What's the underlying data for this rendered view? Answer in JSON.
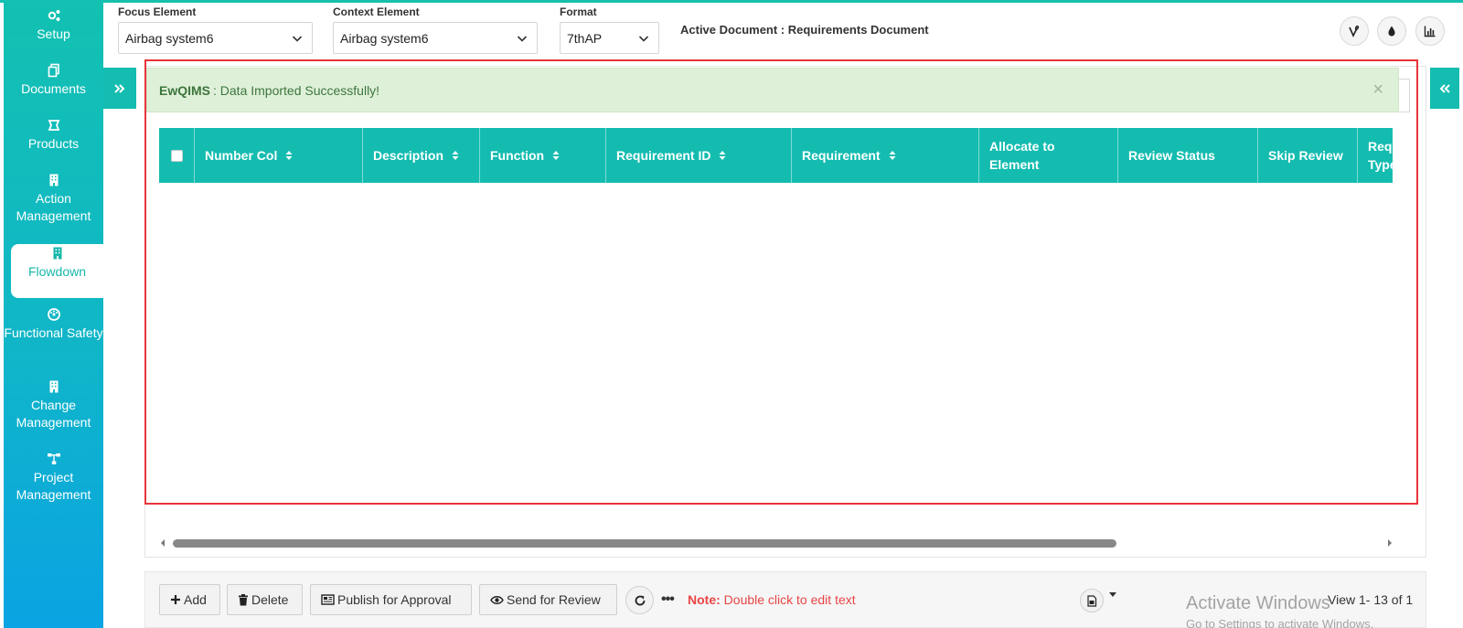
{
  "sidebar": {
    "items": [
      {
        "label": "Setup",
        "icon": "gears-icon"
      },
      {
        "label": "Documents",
        "icon": "copy-icon"
      },
      {
        "label": "Products",
        "icon": "product-icon"
      },
      {
        "label": "Action Management",
        "icon": "building-icon"
      },
      {
        "label": "Flowdown",
        "icon": "building-icon",
        "active": true
      },
      {
        "label": "Functional Safety",
        "icon": "dashboard-icon"
      },
      {
        "label": "Change Management",
        "icon": "building-icon"
      },
      {
        "label": "Project Management",
        "icon": "sitemap-icon"
      }
    ]
  },
  "header": {
    "focus_label": "Focus Element",
    "focus_value": "Airbag system6",
    "context_label": "Context Element",
    "context_value": "Airbag system6",
    "format_label": "Format",
    "format_value": "7thAP",
    "active_document": "Active Document : Requirements Document",
    "icons": [
      "vine-icon",
      "drop-icon",
      "chart-icon"
    ]
  },
  "alert": {
    "brand": "EwQIMS",
    "message": ": Data Imported Successfully!",
    "close": "×"
  },
  "table": {
    "columns": [
      {
        "label": "",
        "type": "checkbox"
      },
      {
        "label": "Number Col",
        "sortable": true
      },
      {
        "label": "Description",
        "sortable": true
      },
      {
        "label": "Function",
        "sortable": true
      },
      {
        "label": "Requirement ID",
        "sortable": true
      },
      {
        "label": "Requirement",
        "sortable": true
      },
      {
        "label": "Allocate to Element",
        "sortable": false
      },
      {
        "label": "Review Status",
        "sortable": false
      },
      {
        "label": "Skip Review",
        "sortable": false
      },
      {
        "label": "Requirement Type",
        "sortable": false
      }
    ],
    "rows": []
  },
  "footer": {
    "add": "Add",
    "delete": "Delete",
    "publish": "Publish for Approval",
    "send_review": "Send for Review",
    "more": "•••",
    "note_label": "Note:",
    "note_text": "Double click to edit text",
    "view_count": "View 1- 13 of 1",
    "watermark_title": "Activate Windows",
    "watermark_sub": "Go to Settings to activate Windows."
  },
  "colors": {
    "accent": "#14bcb0",
    "alert_bg": "#dff0d8",
    "alert_text": "#3c763d",
    "note": "#e84545",
    "frame": "#e8343a"
  }
}
